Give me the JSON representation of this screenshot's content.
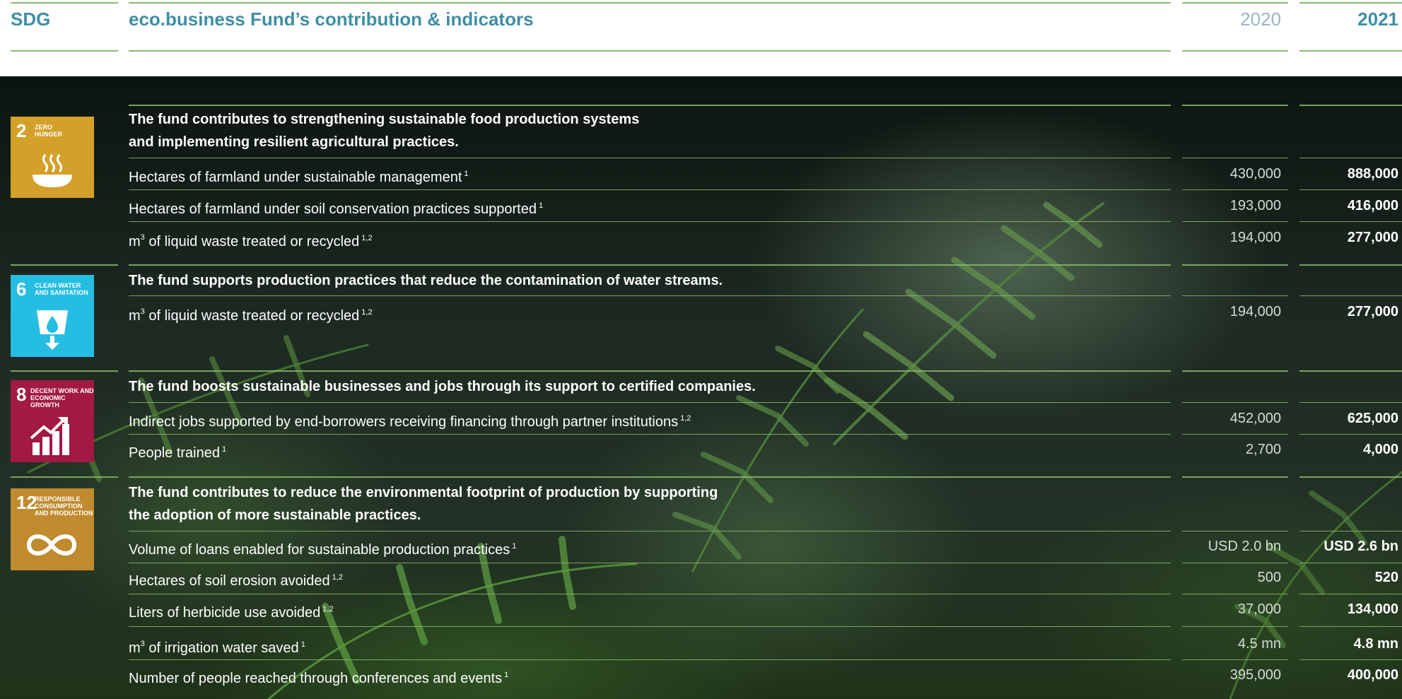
{
  "header": {
    "sdg_label": "SDG",
    "title": "eco.business Fund’s contribution & indicators",
    "year_prev": "2020",
    "year_curr": "2021"
  },
  "colors": {
    "accent": "#3f8ea6",
    "rule": "#8ab86a",
    "sdg2": "#d3a029",
    "sdg6": "#26bde2",
    "sdg8": "#a21942",
    "sdg12": "#bf8b2e"
  },
  "groups": [
    {
      "sdg": {
        "number": "2",
        "caption_1": "ZERO",
        "caption_2": "HUNGER",
        "icon": "bowl-icon"
      },
      "statement_1": "The fund contributes to strengthening sustainable food production systems",
      "statement_2": "and implementing resilient agricultural practices.",
      "rows": [
        {
          "label": "Hectares of farmland under sustainable management",
          "note": "1",
          "v2020": "430,000",
          "v2021": "888,000"
        },
        {
          "label": "Hectares of farmland under soil conservation practices supported",
          "note": "1",
          "v2020": "193,000",
          "v2021": "416,000"
        },
        {
          "label_pre": "m",
          "label_exp": "3",
          "label": " of liquid waste treated or recycled",
          "note": "1,2",
          "v2020": "194,000",
          "v2021": "277,000"
        }
      ]
    },
    {
      "sdg": {
        "number": "6",
        "caption_1": "CLEAN WATER",
        "caption_2": "AND SANITATION",
        "icon": "water-drop-icon"
      },
      "statement_1": "The fund supports production practices that reduce the contamination of water streams.",
      "rows": [
        {
          "label_pre": "m",
          "label_exp": "3",
          "label": " of liquid waste treated or recycled",
          "note": "1,2",
          "v2020": "194,000",
          "v2021": "277,000"
        }
      ]
    },
    {
      "sdg": {
        "number": "8",
        "caption_1": "DECENT WORK AND",
        "caption_2": "ECONOMIC GROWTH",
        "icon": "growth-chart-icon"
      },
      "statement_1": "The fund boosts sustainable businesses and jobs through its support to certified companies.",
      "rows": [
        {
          "label": "Indirect jobs supported by end-borrowers receiving financing through partner institutions",
          "note": "1,2",
          "v2020": "452,000",
          "v2021": "625,000"
        },
        {
          "label": "People trained",
          "note": "1",
          "v2020": "2,700",
          "v2021": "4,000"
        }
      ]
    },
    {
      "sdg": {
        "number": "12",
        "caption_1": "RESPONSIBLE",
        "caption_2": "CONSUMPTION",
        "caption_3": "AND PRODUCTION",
        "icon": "infinity-icon"
      },
      "statement_1": "The fund contributes to reduce the environmental footprint of production by supporting",
      "statement_2": "the adoption of more sustainable practices.",
      "rows": [
        {
          "label": "Volume of loans enabled for sustainable production practices",
          "note": "1",
          "v2020": "USD 2.0 bn",
          "v2021": "USD 2.6 bn"
        },
        {
          "label": "Hectares of soil erosion avoided",
          "note": "1,2",
          "v2020": "500",
          "v2021": "520"
        },
        {
          "label": "Liters of herbicide use avoided",
          "note": "1,2",
          "v2020": "37,000",
          "v2021": "134,000"
        },
        {
          "label_pre": "m",
          "label_exp": "3",
          "label": " of irrigation water saved",
          "note": "1",
          "v2020": "4.5 mn",
          "v2021": "4.8 mn"
        },
        {
          "label": "Number of people reached through conferences and events",
          "note": "1",
          "v2020": "395,000",
          "v2021": "400,000"
        }
      ]
    }
  ]
}
